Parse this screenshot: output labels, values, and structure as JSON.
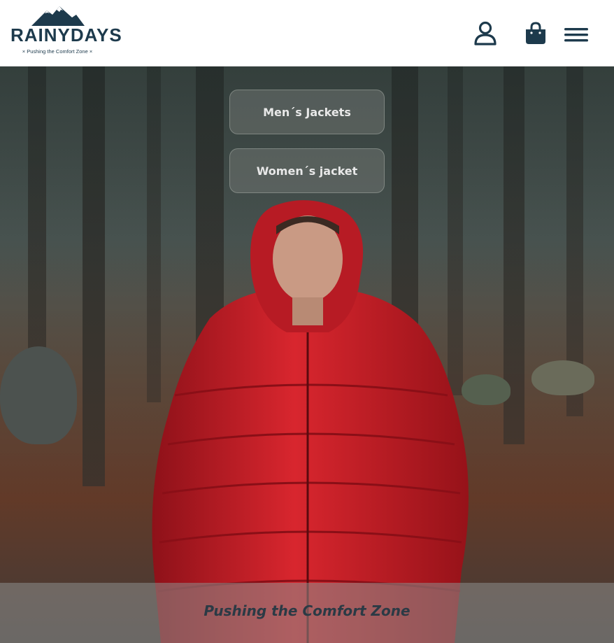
{
  "header": {
    "logo": {
      "brand": "RAINYDAYS",
      "tagline": "× Pushing the Comfort Zone ×"
    },
    "icons": {
      "account": "user-icon",
      "cart": "shopping-bag-icon",
      "menu": "hamburger-menu-icon"
    }
  },
  "categories": [
    {
      "label": "Men´s Jackets"
    },
    {
      "label": "Women´s jacket"
    }
  ],
  "banner": {
    "text": "Pushing the Comfort Zone"
  },
  "colors": {
    "brand": "#1d3a4c",
    "jacket": "#c8202a",
    "button_bg": "#6e7370"
  }
}
